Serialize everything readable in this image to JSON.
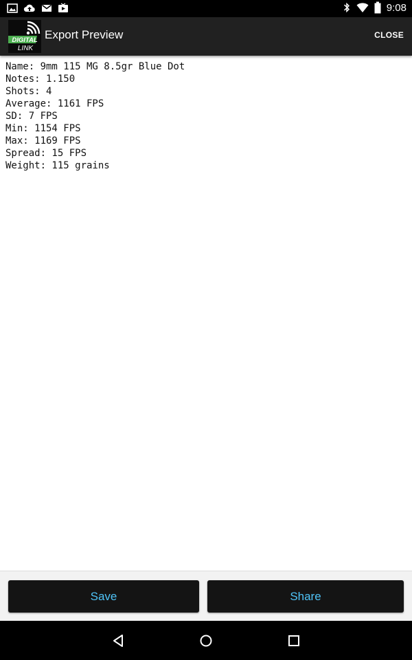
{
  "status_bar": {
    "time": "9:08",
    "left_icons": [
      "image-icon",
      "cloud-upload-icon",
      "gmail-icon",
      "video-icon"
    ],
    "right_icons": [
      "bluetooth-icon",
      "wifi-icon",
      "battery-icon"
    ]
  },
  "action_bar": {
    "logo_text_top": "DIGITAL",
    "logo_text_bottom": "LINK",
    "title": "Export Preview",
    "close_label": "CLOSE"
  },
  "content": {
    "lines": [
      "Name: 9mm 115 MG 8.5gr Blue Dot",
      "Notes: 1.150",
      "Shots: 4",
      "Average: 1161 FPS",
      "SD: 7 FPS",
      "Min: 1154 FPS",
      "Max: 1169 FPS",
      "Spread: 15 FPS",
      "Weight: 115 grains"
    ]
  },
  "buttons": {
    "save_label": "Save",
    "share_label": "Share"
  },
  "colors": {
    "action_bar": "#212121",
    "button_text": "#4fc3f7",
    "logo_green": "#4caf50"
  }
}
